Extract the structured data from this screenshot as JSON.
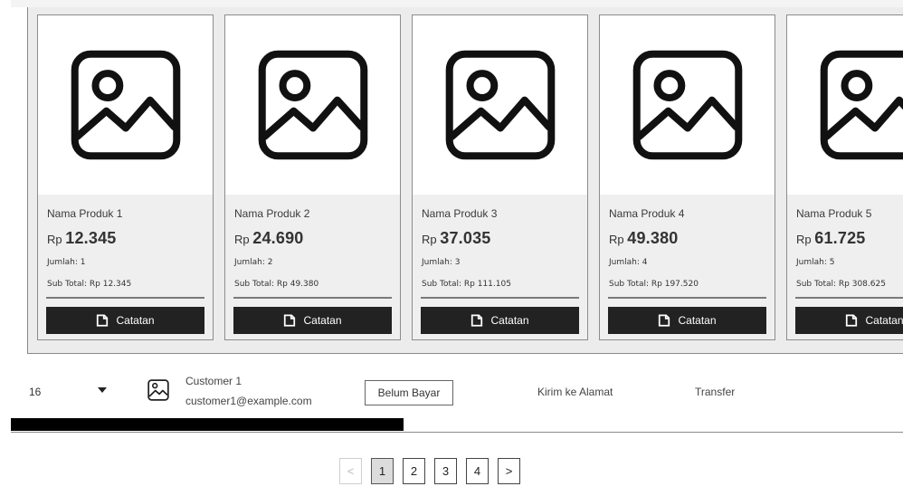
{
  "products": [
    {
      "name": "Nama Produk 1",
      "currency": "Rp",
      "price": "12.345",
      "qty": "Jumlah: 1",
      "subtotal": "Sub Total: Rp 12.345",
      "note_label": "Catatan"
    },
    {
      "name": "Nama Produk 2",
      "currency": "Rp",
      "price": "24.690",
      "qty": "Jumlah: 2",
      "subtotal": "Sub Total: Rp 49.380",
      "note_label": "Catatan"
    },
    {
      "name": "Nama Produk 3",
      "currency": "Rp",
      "price": "37.035",
      "qty": "Jumlah: 3",
      "subtotal": "Sub Total: Rp 111.105",
      "note_label": "Catatan"
    },
    {
      "name": "Nama Produk 4",
      "currency": "Rp",
      "price": "49.380",
      "qty": "Jumlah: 4",
      "subtotal": "Sub Total: Rp 197.520",
      "note_label": "Catatan"
    },
    {
      "name": "Nama Produk 5",
      "currency": "Rp",
      "price": "61.725",
      "qty": "Jumlah: 5",
      "subtotal": "Sub Total: Rp 308.625",
      "note_label": "Catatan"
    }
  ],
  "order_row": {
    "number": "16",
    "customer_name": "Customer 1",
    "customer_email": "customer1@example.com",
    "status": "Belum Bayar",
    "shipping": "Kirim ke Alamat",
    "payment": "Transfer"
  },
  "scroll_progress": 0.44,
  "pagination": {
    "prev": "<",
    "pages": [
      "1",
      "2",
      "3",
      "4"
    ],
    "active": "1",
    "next": ">"
  },
  "icons": {
    "product_image": "image-placeholder-icon",
    "note": "note-icon",
    "expand": "caret-down-icon",
    "avatar": "image-placeholder-icon"
  }
}
